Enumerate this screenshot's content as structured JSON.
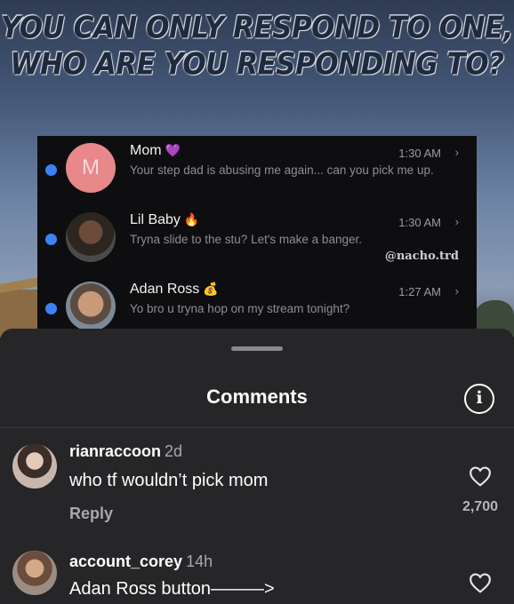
{
  "meme": {
    "title_line1": "YOU CAN ONLY RESPOND TO ONE,",
    "title_line2": "WHO ARE YOU RESPONDING TO?"
  },
  "inbox": {
    "messages": [
      {
        "name": "Mom",
        "emoji": "💜",
        "time": "1:30 AM",
        "text": "Your step dad is abusing me again... can you pick me up.",
        "avatar_letter": "M"
      },
      {
        "name": "Lil Baby",
        "emoji": "🔥",
        "time": "1:30 AM",
        "text": "Tryna slide to the stu? Let's make a banger."
      },
      {
        "name": "Adan Ross",
        "emoji": "💰",
        "time": "1:27 AM",
        "text": "Yo bro u tryna hop on my stream tonight?"
      }
    ],
    "watermark": "@nacho.trd",
    "chevron": "›"
  },
  "comments_sheet": {
    "title": "Comments",
    "info_glyph": "i",
    "comments": [
      {
        "username": "rianraccoon",
        "ago": "2d",
        "text": "who tf wouldn’t pick mom",
        "reply_label": "Reply",
        "likes": "2,700"
      },
      {
        "username": "account_corey",
        "ago": "14h",
        "text": "Adan Ross button———>"
      }
    ]
  },
  "icons": {
    "info": "info-icon",
    "heart": "heart-icon",
    "chevron": "chevron-right-icon"
  },
  "colors": {
    "unread_dot": "#3b82f6",
    "sheet_bg": "#262628",
    "inbox_bg": "#0e0e10"
  }
}
